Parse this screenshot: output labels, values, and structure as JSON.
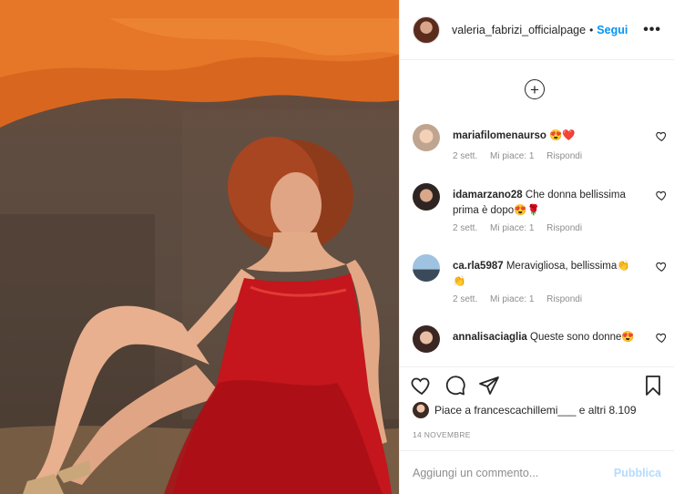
{
  "header": {
    "username": "valeria_fabrizi_officialpage",
    "separator": "•",
    "follow_label": "Segui",
    "more_label": "•••"
  },
  "comments": {
    "load_more_label": "+",
    "items": [
      {
        "user": "mariafilomenaurso",
        "text": "😍❤️",
        "time": "2 sett.",
        "likes": "Mi piace: 1",
        "reply": "Rispondi"
      },
      {
        "user": "idamarzano28",
        "text": "Che donna bellissima prima è dopo😍🌹",
        "time": "2 sett.",
        "likes": "Mi piace: 1",
        "reply": "Rispondi"
      },
      {
        "user": "ca.rla5987",
        "text": "Meravigliosa, bellissima👏👏",
        "time": "2 sett.",
        "likes": "Mi piace: 1",
        "reply": "Rispondi"
      },
      {
        "user": "annalisaciaglia",
        "text": "Queste sono donne😍",
        "time": "",
        "likes": "",
        "reply": ""
      }
    ]
  },
  "likes": {
    "prefix": "Piace a",
    "user": "francescachillemi___",
    "connector": "e altri",
    "count": "8.109"
  },
  "date": "14 NOVEMBRE",
  "add_comment": {
    "placeholder": "Aggiungi un commento...",
    "publish_label": "Pubblica"
  },
  "colors": {
    "accent": "#0095f6",
    "publish_disabled": "#b3dbff",
    "text": "#262626",
    "muted": "#8e8e8e"
  }
}
